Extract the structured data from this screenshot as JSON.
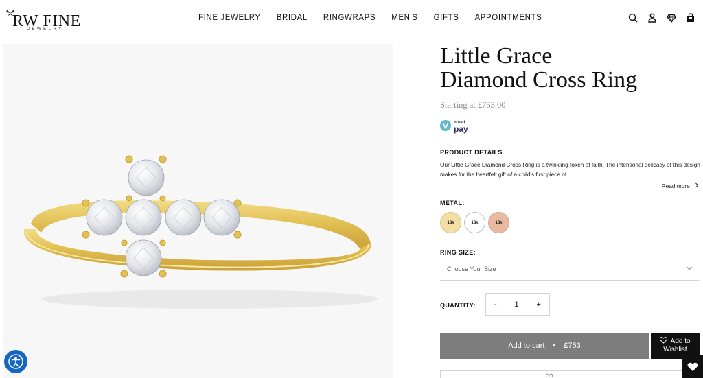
{
  "header": {
    "logo_main": "RW FINE",
    "logo_sub": "JEWELRY",
    "nav": [
      "FINE JEWELRY",
      "BRIDAL",
      "RINGWRAPS",
      "MEN'S",
      "GIFTS",
      "APPOINTMENTS"
    ],
    "icons": [
      "search-icon",
      "account-icon",
      "diamond-icon",
      "bag-icon"
    ]
  },
  "product": {
    "title_line1": "Little Grace",
    "title_line2": "Diamond Cross Ring",
    "price": "Starting at £753.00",
    "bread_small": "bread",
    "bread_pay": "pay",
    "details_heading": "PRODUCT DETAILS",
    "details_text": "Our Little Grace Diamond Cross Ring is a twinkling token of faith. The intentional delicacy of this design makes for the heartfelt gift of a child's first piece of...",
    "read_more": "Read more",
    "metal_heading": "METAL:",
    "metals": [
      {
        "label": "18k",
        "color": "#f3dfa6",
        "border": "#d8c27e"
      },
      {
        "label": "18k",
        "color": "#ffffff",
        "border": "#bdbdbd"
      },
      {
        "label": "18k",
        "color": "#eab9a2",
        "border": "#d5a48e"
      }
    ],
    "ring_size_heading": "RING SIZE:",
    "ring_size_placeholder": "Choose Your Size",
    "quantity_heading": "QUANTITY:",
    "qty_minus": "-",
    "qty_value": "1",
    "qty_plus": "+",
    "add_to_cart": "Add to cart",
    "cart_separator": "•",
    "cart_price": "£753",
    "wishlist_line1": "Add to",
    "wishlist_line2": "Wishlist"
  },
  "colors": {
    "gold": "#e8c85d",
    "cart_button": "#7d7d7d",
    "wishlist_button": "#111111",
    "accessibility": "#1566c0"
  }
}
